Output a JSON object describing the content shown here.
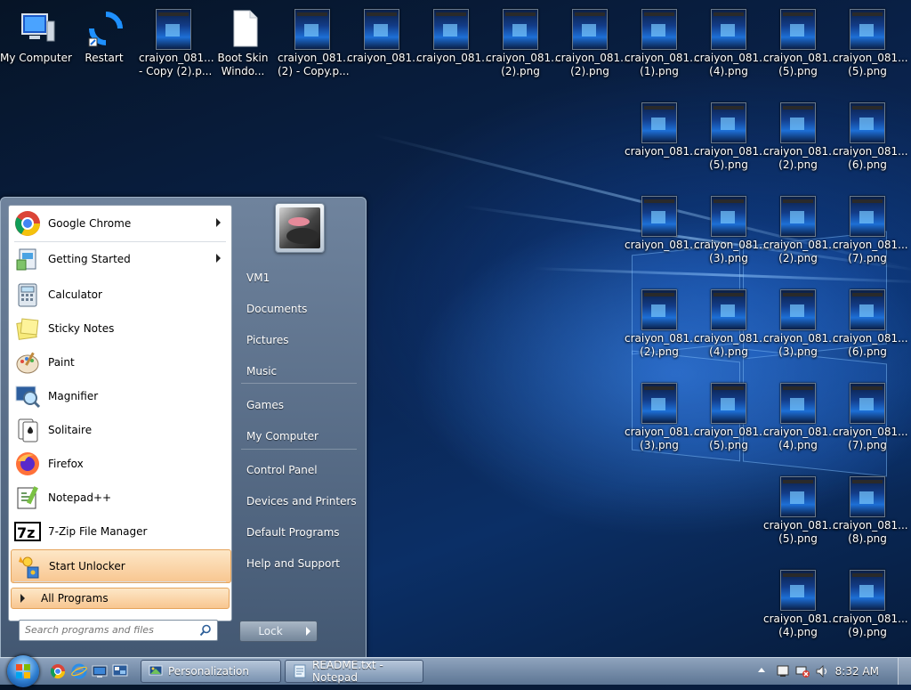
{
  "desktop": {
    "icons_row1": [
      {
        "label1": "My Computer",
        "label2": "",
        "kind": "computer"
      },
      {
        "label1": "Restart",
        "label2": "",
        "kind": "restart"
      },
      {
        "label1": "craiyon_081...",
        "label2": "- Copy (2).p...",
        "kind": "thumb"
      },
      {
        "label1": "Boot Skin",
        "label2": "Windo...",
        "kind": "blank-doc"
      },
      {
        "label1": "craiyon_081...",
        "label2": "(2) - Copy.p...",
        "kind": "thumb"
      },
      {
        "label1": "craiyon_081...",
        "label2": "",
        "kind": "thumb"
      },
      {
        "label1": "craiyon_081...",
        "label2": "",
        "kind": "thumb"
      },
      {
        "label1": "craiyon_081...",
        "label2": "(2).png",
        "kind": "thumb"
      },
      {
        "label1": "craiyon_081...",
        "label2": "(2).png",
        "kind": "thumb"
      },
      {
        "label1": "craiyon_081...",
        "label2": "(1).png",
        "kind": "thumb"
      },
      {
        "label1": "craiyon_081...",
        "label2": "(4).png",
        "kind": "thumb"
      },
      {
        "label1": "craiyon_081...",
        "label2": "(5).png",
        "kind": "thumb"
      },
      {
        "label1": "craiyon_081...",
        "label2": "(5).png",
        "kind": "thumb"
      }
    ],
    "icons_grid": [
      [
        {
          "label1": "craiyon_081...",
          "label2": ""
        },
        {
          "label1": "craiyon_081...",
          "label2": "(5).png"
        },
        {
          "label1": "craiyon_081...",
          "label2": "(2).png"
        },
        {
          "label1": "craiyon_081...",
          "label2": "(6).png"
        }
      ],
      [
        {
          "label1": "craiyon_081...",
          "label2": ""
        },
        {
          "label1": "craiyon_081...",
          "label2": "(3).png"
        },
        {
          "label1": "craiyon_081...",
          "label2": "(2).png"
        },
        {
          "label1": "craiyon_081...",
          "label2": "(7).png"
        }
      ],
      [
        {
          "label1": "craiyon_081...",
          "label2": "(2).png"
        },
        {
          "label1": "craiyon_081...",
          "label2": "(4).png"
        },
        {
          "label1": "craiyon_081...",
          "label2": "(3).png"
        },
        {
          "label1": "craiyon_081...",
          "label2": "(6).png"
        }
      ],
      [
        {
          "label1": "craiyon_081...",
          "label2": "(3).png"
        },
        {
          "label1": "craiyon_081...",
          "label2": "(5).png"
        },
        {
          "label1": "craiyon_081...",
          "label2": "(4).png"
        },
        {
          "label1": "craiyon_081...",
          "label2": "(7).png"
        }
      ],
      [
        null,
        null,
        {
          "label1": "craiyon_081...",
          "label2": "(5).png"
        },
        {
          "label1": "craiyon_081...",
          "label2": "(8).png"
        }
      ],
      [
        null,
        null,
        {
          "label1": "craiyon_081...",
          "label2": "(4).png"
        },
        {
          "label1": "craiyon_081...",
          "label2": "(9).png"
        }
      ]
    ]
  },
  "start_menu": {
    "programs": [
      {
        "label": "Google Chrome",
        "icon": "chrome-icon",
        "submenu": true
      },
      {
        "label": "Getting Started",
        "icon": "getting-started-icon",
        "submenu": true
      },
      {
        "label": "Calculator",
        "icon": "calculator-icon",
        "submenu": false
      },
      {
        "label": "Sticky Notes",
        "icon": "sticky-notes-icon",
        "submenu": false
      },
      {
        "label": "Paint",
        "icon": "paint-icon",
        "submenu": false
      },
      {
        "label": "Magnifier",
        "icon": "magnifier-icon",
        "submenu": false
      },
      {
        "label": "Solitaire",
        "icon": "solitaire-icon",
        "submenu": false
      },
      {
        "label": "Firefox",
        "icon": "firefox-icon",
        "submenu": false
      },
      {
        "label": "Notepad++",
        "icon": "notepad-plus-plus-icon",
        "submenu": false
      },
      {
        "label": "7-Zip File Manager",
        "icon": "7zip-icon",
        "submenu": false
      },
      {
        "label": "Start Unlocker",
        "icon": "start-unlocker-icon",
        "submenu": false,
        "highlighted": true
      }
    ],
    "all_programs": "All Programs",
    "search_placeholder": "Search programs and files",
    "right_items": [
      "VM1",
      "Documents",
      "Pictures",
      "Music",
      "Games",
      "My Computer",
      "Control Panel",
      "Devices and Printers",
      "Default Programs",
      "Help and Support"
    ],
    "lock_label": "Lock"
  },
  "taskbar": {
    "windows": [
      {
        "label": "Personalization",
        "icon": "personalization-icon"
      },
      {
        "label": "README.txt - Notepad",
        "icon": "notepad-icon"
      }
    ],
    "clock": "8:32 AM"
  },
  "colors": {
    "accent_highlight": "#f8c690",
    "desktop_bg": "#0a2450",
    "taskbar": "#7f97b2"
  }
}
